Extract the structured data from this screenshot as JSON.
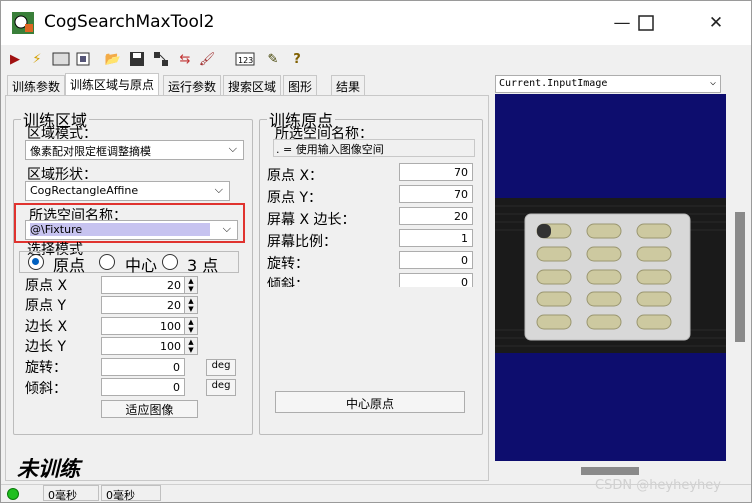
{
  "window": {
    "title": "CogSearchMaxTool2"
  },
  "tabs": [
    "训练参数",
    "训练区域与原点",
    "运行参数",
    "搜索区域",
    "图形",
    "结果"
  ],
  "left_group": {
    "legend": "训练区域",
    "region_mode_label": "区域模式：",
    "region_mode_value": "像素配对限定框调整摘模",
    "region_shape_label": "区域形状：",
    "region_shape_value": "CogRectangleAffine",
    "space_label": "所选空间名称：",
    "space_value": "@\\Fixture",
    "select_mode_label": "选择模式",
    "radio_origin": "原点",
    "radio_center": "中心",
    "radio_three": "3 点",
    "fields": [
      {
        "label": "原点 X",
        "value": "20"
      },
      {
        "label": "原点 Y",
        "value": "20"
      },
      {
        "label": "边长 X",
        "value": "100"
      },
      {
        "label": "边长 Y",
        "value": "100"
      },
      {
        "label": "旋转：",
        "value": "0"
      },
      {
        "label": "倾斜：",
        "value": "0"
      }
    ],
    "deg_label": "deg",
    "fit_button": "适应图像"
  },
  "right_group": {
    "legend": "训练原点",
    "space_label": "所选空间名称：",
    "space_value": ". = 使用输入图像空间",
    "fields": [
      {
        "label": "原点 X：",
        "value": "70"
      },
      {
        "label": "原点 Y：",
        "value": "70"
      },
      {
        "label": "屏幕 X 边长：",
        "value": "20"
      },
      {
        "label": "屏幕比例：",
        "value": "1"
      },
      {
        "label": "旋转：",
        "value": "0"
      },
      {
        "label": "倾斜：",
        "value": "0"
      }
    ],
    "center_button": "中心原点"
  },
  "status": {
    "train_state": "未训练",
    "time1": "0毫秒",
    "time2": "0毫秒"
  },
  "image_panel": {
    "selector_value": "Current.InputImage"
  },
  "watermark": "CSDN @heyheyhey",
  "colors": {
    "highlight_box": "#e0332f",
    "image_bg": "#0d0d6e",
    "selection": "#c7c3f0"
  }
}
